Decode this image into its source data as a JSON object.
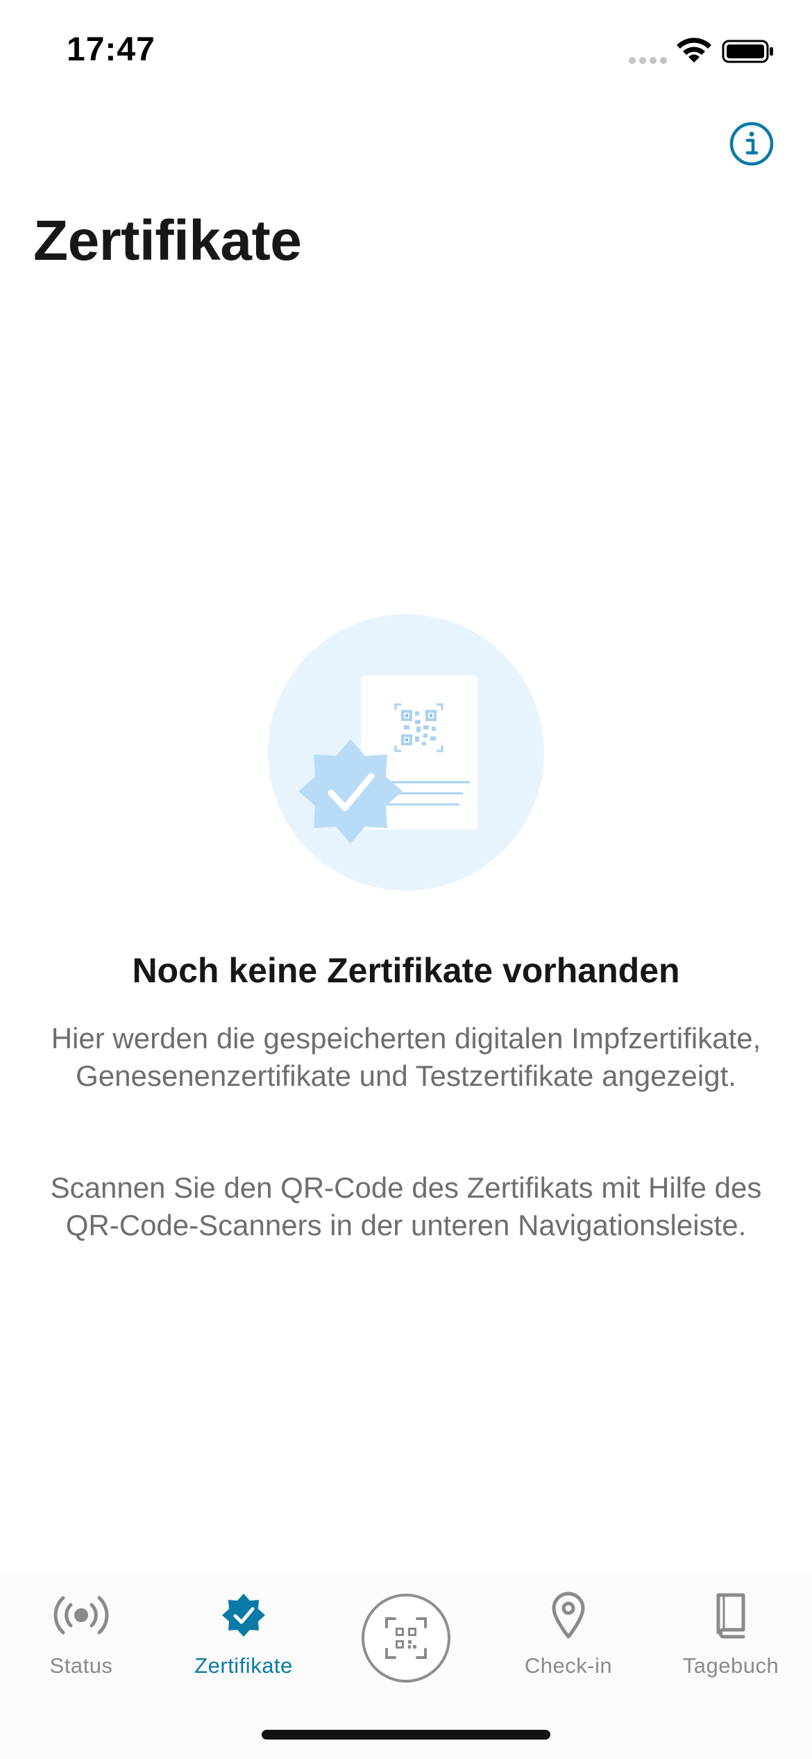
{
  "status_bar": {
    "time": "17:47"
  },
  "header": {
    "title": "Zertifikate"
  },
  "empty_state": {
    "title": "Noch keine Zertifikate vorhanden",
    "description": "Hier werden die gespeicherten digitalen Impfzertifikate, Genesenenzertifikate und Testzertifikate angezeigt.",
    "hint": "Scannen Sie den QR-Code des Zertifikats mit Hilfe des QR-Code-Scanners in der unteren Navigationsleiste."
  },
  "tab_bar": {
    "active": "Zertifikate",
    "tabs": [
      {
        "label": "Status",
        "icon": "broadcast-icon"
      },
      {
        "label": "Zertifikate",
        "icon": "certificate-badge-icon"
      },
      {
        "label": "",
        "icon": "qr-scanner-icon"
      },
      {
        "label": "Check-in",
        "icon": "location-pin-icon"
      },
      {
        "label": "Tagebuch",
        "icon": "book-icon"
      }
    ]
  },
  "colors": {
    "accent": "#0a7aa8",
    "inactive": "#8a8a8a",
    "illustration_bg": "#e8f4fd",
    "badge": "#b8dcf7"
  }
}
